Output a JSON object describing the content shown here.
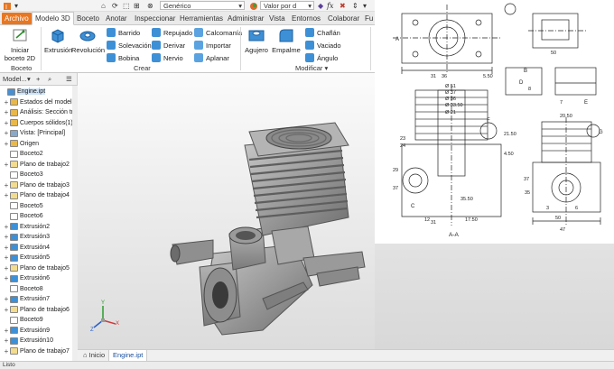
{
  "quick_access": {
    "material": "Genérico",
    "appearance": "Valor por d",
    "fx": "fx"
  },
  "tabs": [
    "Archivo",
    "Modelo 3D",
    "Boceto",
    "Anotar",
    "Inspeccionar",
    "Herramientas",
    "Administrar",
    "Vista",
    "Entornos",
    "Colaborar",
    "Fu"
  ],
  "ribbon": {
    "sketch_button": "Iniciar boceto 2D",
    "sketch_group": "Boceto",
    "extrusion": "Extrusión",
    "revolution": "Revolución",
    "sweep": "Barrido",
    "loft": "Solevación",
    "coil": "Bobina",
    "rib": "Repujado",
    "derive": "Derivar",
    "rib2": "Nervio",
    "decal": "Calcomanía",
    "import": "Importar",
    "flatten": "Aplanar",
    "create_group": "Crear",
    "hole": "Agujero",
    "fillet": "Empalme",
    "chamfer": "Chaflán",
    "shell": "Vaciado",
    "draft": "Ángulo",
    "modify_group": "Modificar"
  },
  "browser": {
    "tab": "Model...",
    "nodes": [
      {
        "label": "Engine.ipt",
        "level": 0,
        "pm": "",
        "icon": "part-icon",
        "color": "#4a8fd0"
      },
      {
        "label": "Estados del modelo:",
        "level": 1,
        "pm": "+",
        "icon": "folder-icon",
        "color": "#e8b84a"
      },
      {
        "label": "Análisis: Sección tran",
        "level": 1,
        "pm": "+",
        "icon": "folder-icon",
        "color": "#e8b84a"
      },
      {
        "label": "Cuerpos sólidos(1)",
        "level": 1,
        "pm": "+",
        "icon": "folder-icon",
        "color": "#e8b84a"
      },
      {
        "label": "Vista: [Principal]",
        "level": 1,
        "pm": "+",
        "icon": "view-icon",
        "color": "#8aa9c9"
      },
      {
        "label": "Origen",
        "level": 1,
        "pm": "+",
        "icon": "folder-icon",
        "color": "#e8b84a"
      },
      {
        "label": "Boceto2",
        "level": 1,
        "pm": "",
        "icon": "sketch-icon",
        "color": "#ffffff"
      },
      {
        "label": "Plano de trabajo2",
        "level": 1,
        "pm": "+",
        "icon": "plane-icon",
        "color": "#f2dc8f"
      },
      {
        "label": "Boceto3",
        "level": 1,
        "pm": "",
        "icon": "sketch-icon",
        "color": "#ffffff"
      },
      {
        "label": "Plano de trabajo3",
        "level": 1,
        "pm": "+",
        "icon": "plane-icon",
        "color": "#f2dc8f"
      },
      {
        "label": "Plano de trabajo4",
        "level": 1,
        "pm": "+",
        "icon": "plane-icon",
        "color": "#f2dc8f"
      },
      {
        "label": "Boceto5",
        "level": 1,
        "pm": "",
        "icon": "sketch-icon",
        "color": "#ffffff"
      },
      {
        "label": "Boceto6",
        "level": 1,
        "pm": "",
        "icon": "sketch-icon",
        "color": "#ffffff"
      },
      {
        "label": "Extrusión2",
        "level": 1,
        "pm": "+",
        "icon": "extrude-icon",
        "color": "#3e90d6"
      },
      {
        "label": "Extrusión3",
        "level": 1,
        "pm": "+",
        "icon": "extrude-icon",
        "color": "#3e90d6"
      },
      {
        "label": "Extrusión4",
        "level": 1,
        "pm": "+",
        "icon": "extrude-icon",
        "color": "#3e90d6"
      },
      {
        "label": "Extrusión5",
        "level": 1,
        "pm": "+",
        "icon": "extrude-icon",
        "color": "#3e90d6"
      },
      {
        "label": "Plano de trabajo5",
        "level": 1,
        "pm": "+",
        "icon": "plane-icon",
        "color": "#f2dc8f"
      },
      {
        "label": "Extrusión6",
        "level": 1,
        "pm": "+",
        "icon": "extrude-icon",
        "color": "#3e90d6"
      },
      {
        "label": "Boceto8",
        "level": 1,
        "pm": "",
        "icon": "sketch-icon",
        "color": "#ffffff"
      },
      {
        "label": "Extrusión7",
        "level": 1,
        "pm": "+",
        "icon": "extrude-icon",
        "color": "#3e90d6"
      },
      {
        "label": "Plano de trabajo6",
        "level": 1,
        "pm": "+",
        "icon": "plane-icon",
        "color": "#f2dc8f"
      },
      {
        "label": "Boceto9",
        "level": 1,
        "pm": "",
        "icon": "sketch-icon",
        "color": "#ffffff"
      },
      {
        "label": "Extrusión9",
        "level": 1,
        "pm": "+",
        "icon": "extrude-icon",
        "color": "#3e90d6"
      },
      {
        "label": "Extrusión10",
        "level": 1,
        "pm": "+",
        "icon": "extrude-icon",
        "color": "#3e90d6"
      },
      {
        "label": "Plano de trabajo7",
        "level": 1,
        "pm": "+",
        "icon": "plane-icon",
        "color": "#f2dc8f"
      }
    ]
  },
  "axis": {
    "x": "X",
    "y": "Y",
    "z": "Z"
  },
  "drawing": {
    "section_label": "A-A",
    "dims": [
      "31",
      "36",
      "5.50",
      "50",
      "Ø 51",
      "Ø 37",
      "Ø 36",
      "Ø 33.50",
      "Ø 21",
      "23",
      "24",
      "29",
      "37",
      "31",
      "35.50",
      "21.50",
      "4.50",
      "17.50",
      "12",
      "20.50",
      "50",
      "47",
      "37",
      "35",
      "3",
      "6",
      "7",
      "8",
      "A",
      "B",
      "C",
      "D",
      "E",
      "F",
      "G"
    ]
  },
  "doc_tabs": {
    "home": "Inicio",
    "active": "Engine.ipt"
  },
  "status": "Listo"
}
